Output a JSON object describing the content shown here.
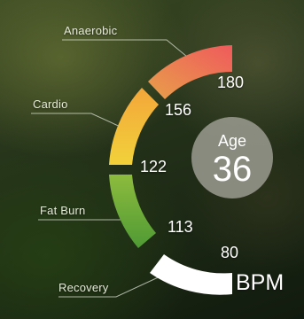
{
  "zones": [
    {
      "name": "Anaerobic",
      "color": "#ec6a5c"
    },
    {
      "name": "Cardio",
      "color": "#f1c036"
    },
    {
      "name": "Fat Burn",
      "color": "#63a63b"
    },
    {
      "name": "Recovery",
      "color": "#ffffff"
    }
  ],
  "bpm_thresholds": {
    "anaerobic": "180",
    "cardio": "156",
    "fat_burn_upper": "122",
    "fat_burn_lower": "113",
    "recovery": "80"
  },
  "unit": "BPM",
  "age": {
    "label": "Age",
    "value": "36"
  }
}
